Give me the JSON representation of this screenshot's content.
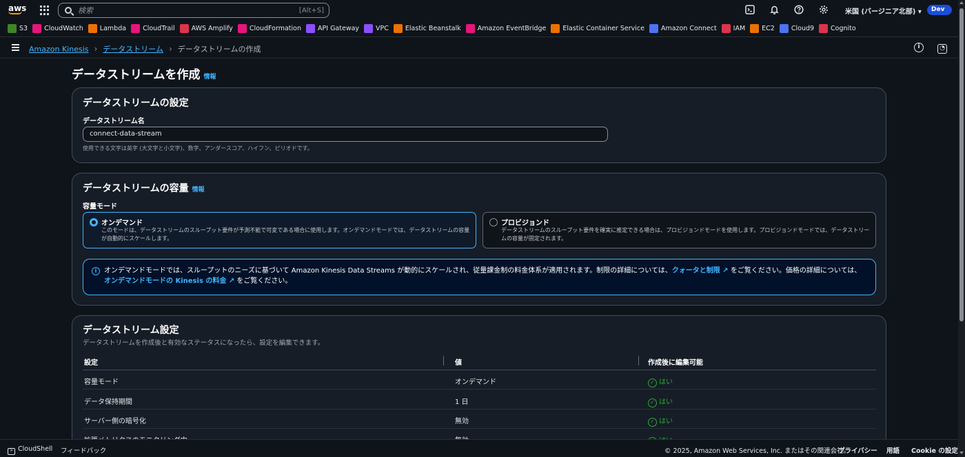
{
  "topnav": {
    "logo": "aws",
    "search_placeholder": "検索",
    "search_shortcut": "[Alt+S]",
    "region": "米国 (バージニア北部) ▾",
    "account_badge": "Dev",
    "icons": [
      "cloudshell-icon",
      "bell-icon",
      "help-icon",
      "gear-icon"
    ]
  },
  "favorites": [
    {
      "label": "S3",
      "color": "#3f8624"
    },
    {
      "label": "CloudWatch",
      "color": "#e7157b"
    },
    {
      "label": "Lambda",
      "color": "#ed7100"
    },
    {
      "label": "CloudTrail",
      "color": "#e7157b"
    },
    {
      "label": "AWS Amplify",
      "color": "#dd344c"
    },
    {
      "label": "CloudFormation",
      "color": "#e7157b"
    },
    {
      "label": "API Gateway",
      "color": "#8c4fff"
    },
    {
      "label": "VPC",
      "color": "#8c4fff"
    },
    {
      "label": "Elastic Beanstalk",
      "color": "#ed7100"
    },
    {
      "label": "Amazon EventBridge",
      "color": "#e7157b"
    },
    {
      "label": "Elastic Container Service",
      "color": "#ed7100"
    },
    {
      "label": "Amazon Connect",
      "color": "#4d72f3"
    },
    {
      "label": "IAM",
      "color": "#dd344c"
    },
    {
      "label": "EC2",
      "color": "#ed7100"
    },
    {
      "label": "Cloud9",
      "color": "#4d72f3"
    },
    {
      "label": "Cognito",
      "color": "#dd344c"
    }
  ],
  "breadcrumb": {
    "items": [
      "Amazon Kinesis",
      "データストリーム"
    ],
    "current": "データストリームの作成"
  },
  "page": {
    "title": "データストリームを作成",
    "info": "情報"
  },
  "config_panel": {
    "title": "データストリームの設定",
    "name_label": "データストリーム名",
    "name_value": "connect-data-stream",
    "name_hint": "使用できる文字は英字 (大文字と小文字)、数字、アンダースコア、ハイフン、ピリオドです。"
  },
  "capacity_panel": {
    "title": "データストリームの容量",
    "info": "情報",
    "mode_label": "容量モード",
    "options": [
      {
        "title": "オンデマンド",
        "desc": "このモードは、データストリームのスループット要件が予測不能で可変である場合に使用します。オンデマンドモードでは、データストリームの容量が自動的にスケールします。",
        "selected": true
      },
      {
        "title": "プロビジョンド",
        "desc": "データストリームのスループット要件を確実に推定できる場合は、プロビジョンドモードを使用します。プロビジョンドモードでは、データストリームの容量が固定されます。",
        "selected": false
      }
    ],
    "alert": {
      "text1": "オンデマンドモードでは、スループットのニーズに基づいて Amazon Kinesis Data Streams が動的にスケールされ、従量課金制の料金体系が適用されます。制限の詳細については、",
      "link1": "クォータと制限",
      "text2": " をご覧ください。価格の詳細については、",
      "link2": "オンデマンドモードの Kinesis の料金",
      "text3": " をご覧ください。"
    }
  },
  "settings_panel": {
    "title": "データストリーム設定",
    "subtitle": "データストリームを作成後と有効なステータスになったら、設定を編集できます。",
    "columns": [
      "設定",
      "値",
      "作成後に編集可能"
    ],
    "rows": [
      {
        "setting": "容量モード",
        "value": "オンデマンド",
        "editable": "はい"
      },
      {
        "setting": "データ保持期間",
        "value": "1 日",
        "editable": "はい"
      },
      {
        "setting": "サーバー側の暗号化",
        "value": "無効",
        "editable": "はい"
      },
      {
        "setting": "拡張メトリクスのモニタリング中",
        "value": "無効",
        "editable": "はい"
      }
    ]
  },
  "footer": {
    "cloudshell": "CloudShell",
    "feedback": "フィードバック",
    "copyright": "© 2025, Amazon Web Services, Inc. またはその関連会社。",
    "privacy": "プライバシー",
    "terms": "用語",
    "cookie": "Cookie の設定"
  }
}
